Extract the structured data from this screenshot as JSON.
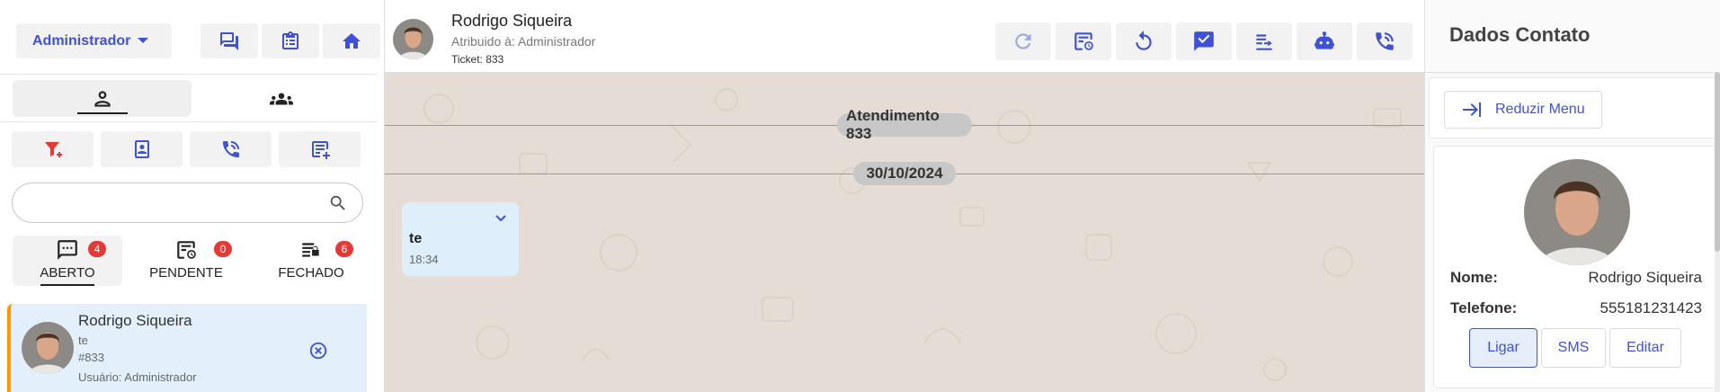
{
  "sidebar": {
    "role_selector": "Administrador",
    "search": {
      "value": "",
      "placeholder": ""
    },
    "status_tabs": [
      {
        "label": "ABERTO",
        "count": "4"
      },
      {
        "label": "PENDENTE",
        "count": "0"
      },
      {
        "label": "FECHADO",
        "count": "6"
      }
    ],
    "ticket": {
      "name": "Rodrigo Siqueira",
      "last_message": "te",
      "number": "#833",
      "user": "Usuário: Administrador"
    }
  },
  "chat": {
    "contact_name": "Rodrigo Siqueira",
    "assigned": "Atribuido à: Administrador",
    "ticket": "Ticket: 833",
    "service_chip": "Atendimento 833",
    "date_chip": "30/10/2024",
    "messages": [
      {
        "text": "te",
        "time": "18:34"
      }
    ]
  },
  "contact_panel": {
    "title": "Dados Contato",
    "reduce_label": "Reduzir Menu",
    "name_label": "Nome:",
    "name_value": "Rodrigo Siqueira",
    "phone_label": "Telefone:",
    "phone_value": "555181231423",
    "buttons": {
      "call": "Ligar",
      "sms": "SMS",
      "edit": "Editar"
    }
  },
  "colors": {
    "accent": "#3f51d6",
    "badge": "#e53935",
    "ticket_card_bg": "#e3f0fc",
    "ticket_card_border": "#ff9800",
    "chat_bg": "#e5ddd5"
  }
}
